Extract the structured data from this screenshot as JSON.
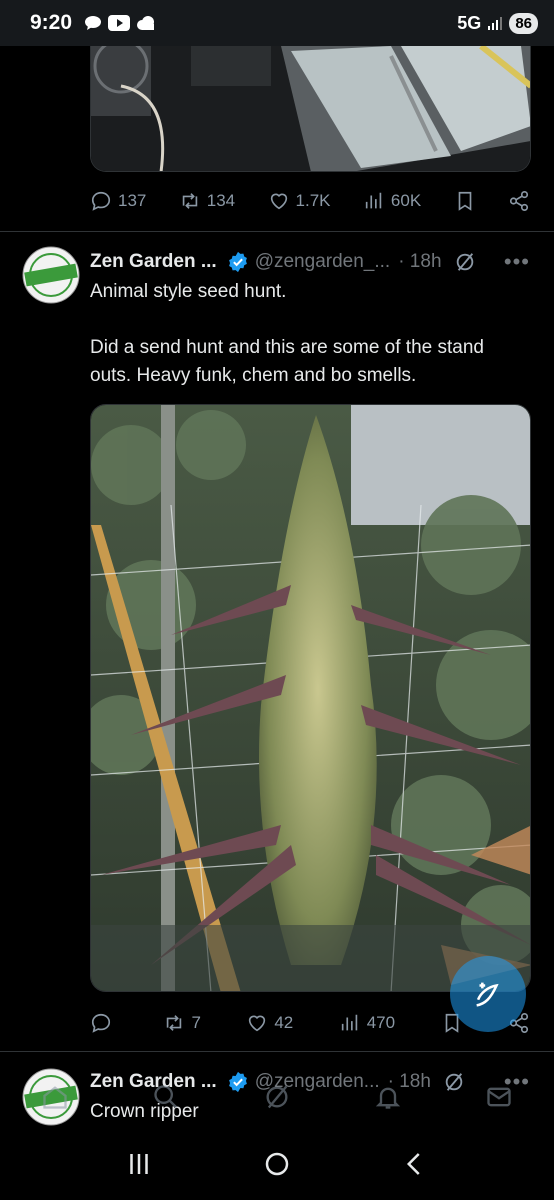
{
  "status_bar": {
    "time": "9:20",
    "network": "5G",
    "battery": "86"
  },
  "prev_tweet": {
    "replies": "137",
    "reposts": "134",
    "likes": "1.7K",
    "views": "60K"
  },
  "tweet1": {
    "name": "Zen Garden ...",
    "handle": "@zengarden_...",
    "time": "· 18h",
    "line1": "Animal style seed hunt.",
    "line2": "Did a send hunt and this are some of the stand outs. Heavy funk, chem and bo smells.",
    "replies": "",
    "reposts": "7",
    "likes": "42",
    "views": "470"
  },
  "tweet2": {
    "name": "Zen Garden ...",
    "handle": "@zengarden...",
    "time": "· 18h",
    "text": "Crown ripper"
  },
  "avatar_badge": {
    "top": "VERIFIED",
    "center": "VERIFIED"
  },
  "colors": {
    "accent": "#1d9bf0",
    "muted": "#71767b",
    "text": "#e7e9ea",
    "background": "#000000"
  }
}
